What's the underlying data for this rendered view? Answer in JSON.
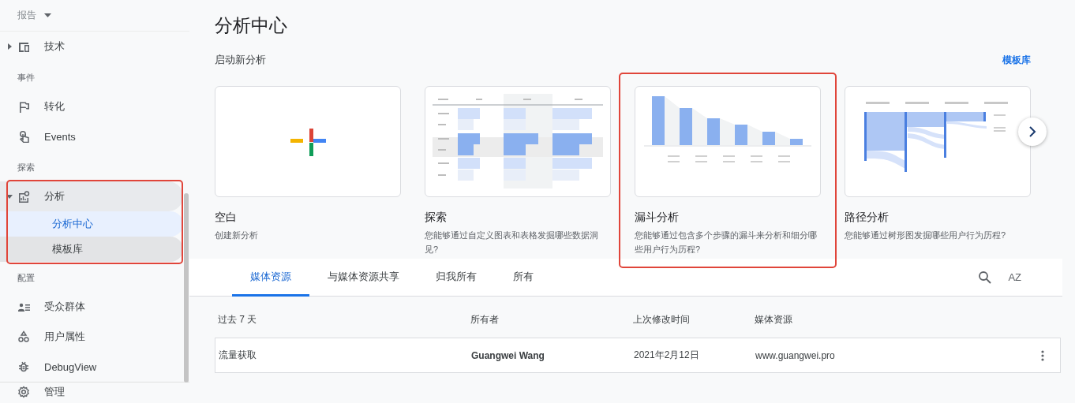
{
  "sidebar": {
    "header": {
      "label": "报告"
    },
    "items": [
      {
        "kind": "expandable",
        "label": "技术",
        "expanded": false
      },
      {
        "kind": "heading",
        "label": "事件"
      },
      {
        "kind": "item",
        "label": "转化"
      },
      {
        "kind": "item",
        "label": "Events"
      },
      {
        "kind": "heading",
        "label": "探索"
      },
      {
        "kind": "group",
        "label": "分析",
        "expanded": true,
        "highlighted": true,
        "children": [
          {
            "label": "分析中心",
            "selected": true,
            "hovered": false
          },
          {
            "label": "模板库",
            "selected": false,
            "hovered": true
          }
        ]
      },
      {
        "kind": "heading",
        "label": "配置"
      },
      {
        "kind": "item",
        "label": "受众群体"
      },
      {
        "kind": "item",
        "label": "用户属性"
      },
      {
        "kind": "item",
        "label": "DebugView"
      },
      {
        "kind": "footer",
        "label": "管理"
      }
    ]
  },
  "main": {
    "title": "分析中心",
    "subtitle": "启动新分析",
    "gallery_link": "模板库",
    "cards": [
      {
        "kind": "blank",
        "title": "空白",
        "description": "创建新分析",
        "highlighted": false
      },
      {
        "kind": "exploration",
        "title": "探索",
        "description": "您能够通过自定义图表和表格发掘哪些数据洞见?",
        "highlighted": false
      },
      {
        "kind": "funnel",
        "title": "漏斗分析",
        "description": "您能够通过包含多个步骤的漏斗来分析和细分哪些用户行为历程?",
        "highlighted": true
      },
      {
        "kind": "path",
        "title": "路径分析",
        "description": "您能够通过树形图发掘哪些用户行为历程?",
        "highlighted": false
      }
    ],
    "tabs": [
      {
        "label": "媒体资源",
        "selected": true
      },
      {
        "label": "与媒体资源共享",
        "selected": false
      },
      {
        "label": "归我所有",
        "selected": false
      },
      {
        "label": "所有",
        "selected": false
      }
    ],
    "sort_label": "AZ",
    "table": {
      "columns": [
        "过去 7 天",
        "所有者",
        "上次修改时间",
        "媒体资源"
      ],
      "rows": [
        [
          "流量获取",
          "Guangwei Wang",
          "2021年2月12日",
          "www.guangwei.pro"
        ]
      ]
    }
  }
}
